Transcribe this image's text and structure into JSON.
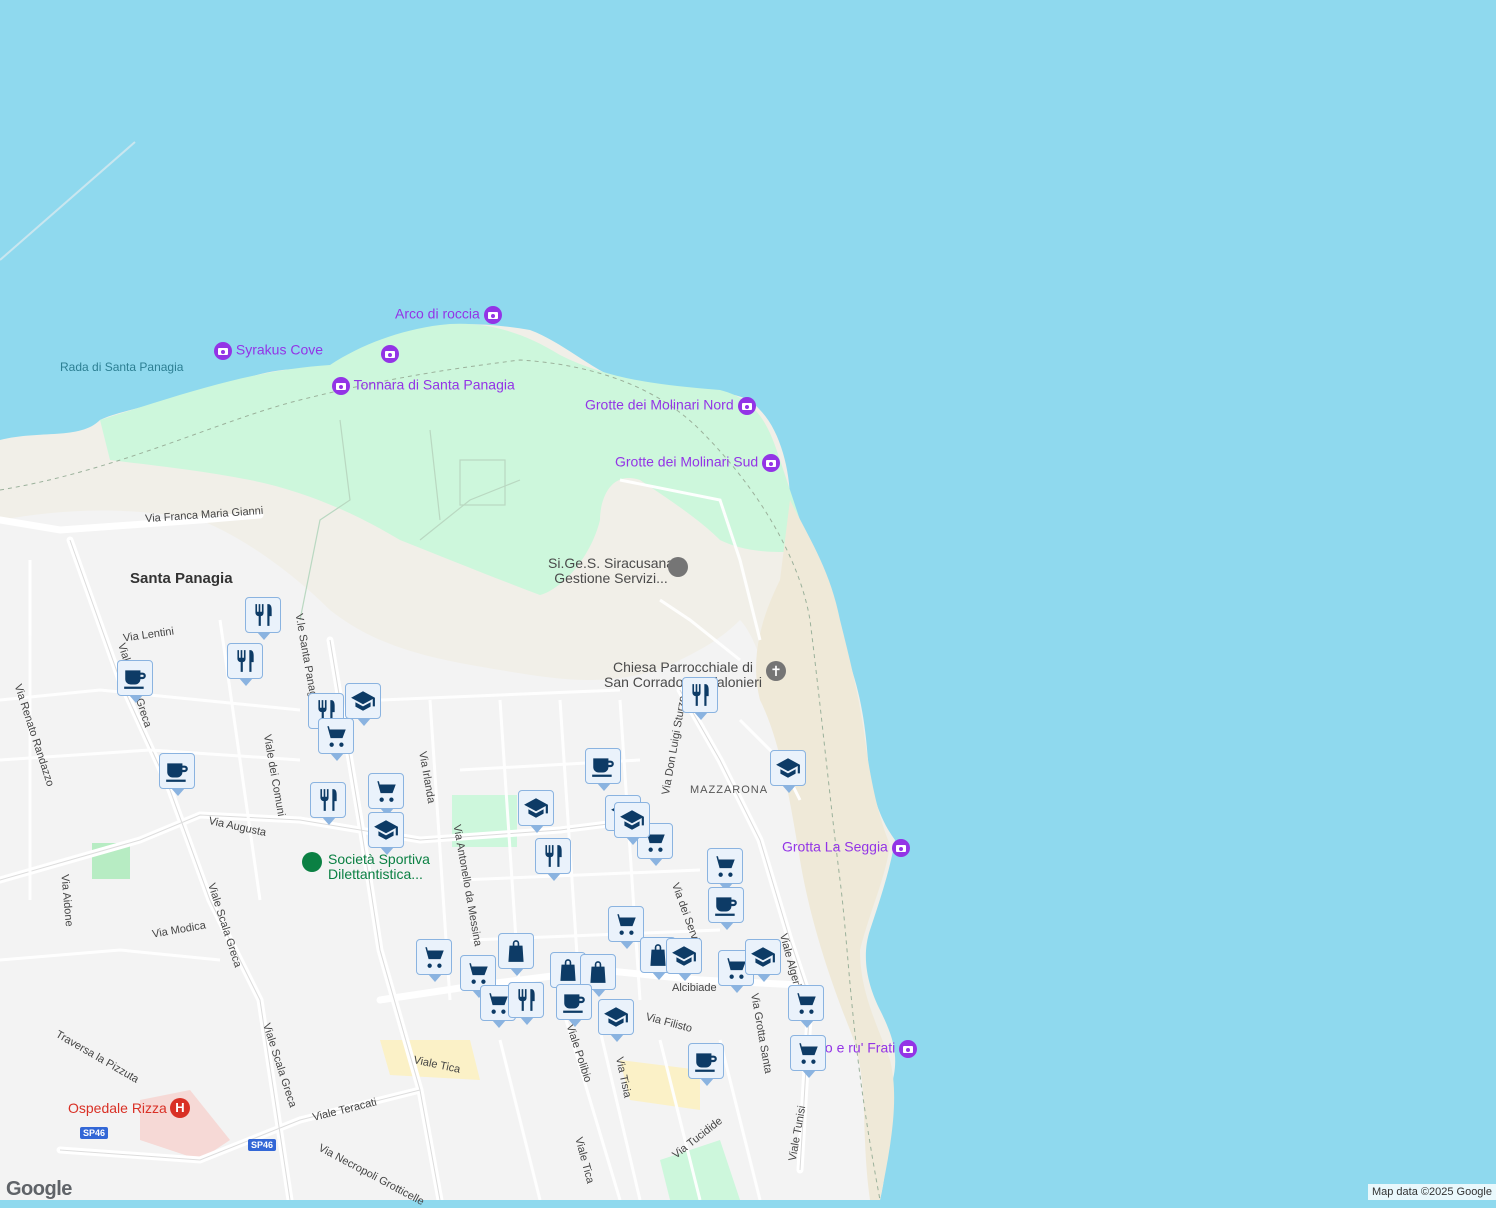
{
  "map": {
    "water_labels": [
      {
        "text": "Rada di Santa\nPanagia"
      }
    ],
    "poi_purple": [
      {
        "name": "Arco di roccia"
      },
      {
        "name": "Syrakus Cove"
      },
      {
        "name": "Tonnara di Santa Panagia"
      },
      {
        "name": "Grotte dei Molinari Nord"
      },
      {
        "name": "Grotte dei Molinari Sud"
      },
      {
        "name": "Grotta La Seggia"
      },
      {
        "name": "S... o e ru' Frati"
      }
    ],
    "poi_dark": [
      {
        "name": "Si.Ge.S. Siracusana\nGestione Servizi..."
      },
      {
        "name": "Chiesa Parrocchiale di\nSan Corrado Confalonieri"
      }
    ],
    "poi_green": [
      {
        "name": "Società Sportiva\nDilettantistica..."
      }
    ],
    "poi_red": [
      {
        "name": "Ospedale Rizza"
      }
    ],
    "districts": [
      {
        "name": "Santa Panagia"
      }
    ],
    "neighborhoods": [
      {
        "name": "MAZZARONA"
      }
    ],
    "roads": [
      {
        "name": "Via Franca Maria Gianni"
      },
      {
        "name": "Via Lentini"
      },
      {
        "name": "V.le Santa Panag"
      },
      {
        "name": "Viale dei Comuni"
      },
      {
        "name": "Via Augusta"
      },
      {
        "name": "Via Irlanda"
      },
      {
        "name": "Via Antonello da Messina"
      },
      {
        "name": "Via Aidone"
      },
      {
        "name": "Via Modica"
      },
      {
        "name": "Viale Scala Greca"
      },
      {
        "name": "Viale Scala Greca"
      },
      {
        "name": "Traversa la Pizzuta"
      },
      {
        "name": "Viale Tica"
      },
      {
        "name": "Viale Teracati"
      },
      {
        "name": "Via Necropoli Grotticelle"
      },
      {
        "name": "Viale Polibio"
      },
      {
        "name": "Via Tisia"
      },
      {
        "name": "Viale Tica"
      },
      {
        "name": "Via Tucidide"
      },
      {
        "name": "Viale Tunisi"
      },
      {
        "name": "Via Grotta Santa"
      },
      {
        "name": "Viale Algeri"
      },
      {
        "name": "Via Don Luigi Sturzo"
      },
      {
        "name": "Via dei Servi"
      },
      {
        "name": "Via Renato Randazzo"
      },
      {
        "name": "Viale Scala Greca"
      },
      {
        "name": "Alcibiade"
      },
      {
        "name": "Via Filisto"
      }
    ],
    "route_badges": [
      {
        "text": "SP46"
      },
      {
        "text": "SP46"
      }
    ],
    "markers": [
      {
        "icon": "restaurant-icon"
      },
      {
        "icon": "restaurant-icon"
      },
      {
        "icon": "cafe-icon"
      },
      {
        "icon": "cafe-icon"
      },
      {
        "icon": "restaurant-icon"
      },
      {
        "icon": "school-icon"
      },
      {
        "icon": "shopping-cart-icon"
      },
      {
        "icon": "restaurant-icon"
      },
      {
        "icon": "shopping-cart-icon"
      },
      {
        "icon": "school-icon"
      },
      {
        "icon": "school-icon"
      },
      {
        "icon": "restaurant-icon"
      },
      {
        "icon": "cafe-icon"
      },
      {
        "icon": "school-icon"
      },
      {
        "icon": "shopping-cart-icon"
      },
      {
        "icon": "school-icon"
      },
      {
        "icon": "restaurant-icon"
      },
      {
        "icon": "school-icon"
      },
      {
        "icon": "shopping-cart-icon"
      },
      {
        "icon": "cafe-icon"
      },
      {
        "icon": "shopping-cart-icon"
      },
      {
        "icon": "shopping-cart-icon"
      },
      {
        "icon": "shopping-bag-icon"
      },
      {
        "icon": "shopping-cart-icon"
      },
      {
        "icon": "shopping-bag-icon"
      },
      {
        "icon": "shopping-bag-icon"
      },
      {
        "icon": "shopping-cart-icon"
      },
      {
        "icon": "restaurant-icon"
      },
      {
        "icon": "cafe-icon"
      },
      {
        "icon": "school-icon"
      },
      {
        "icon": "shopping-bag-icon"
      },
      {
        "icon": "school-icon"
      },
      {
        "icon": "shopping-cart-icon"
      },
      {
        "icon": "school-icon"
      },
      {
        "icon": "shopping-cart-icon"
      },
      {
        "icon": "shopping-cart-icon"
      },
      {
        "icon": "cafe-icon"
      }
    ],
    "colors": {
      "water": "#8fd9ee",
      "park": "#cdf7dc",
      "land": "#f1efe8",
      "urban": "#f3f3f3",
      "poi_purple": "#9334e6"
    }
  },
  "logo": "Google",
  "attribution": "Map data ©2025 Google"
}
